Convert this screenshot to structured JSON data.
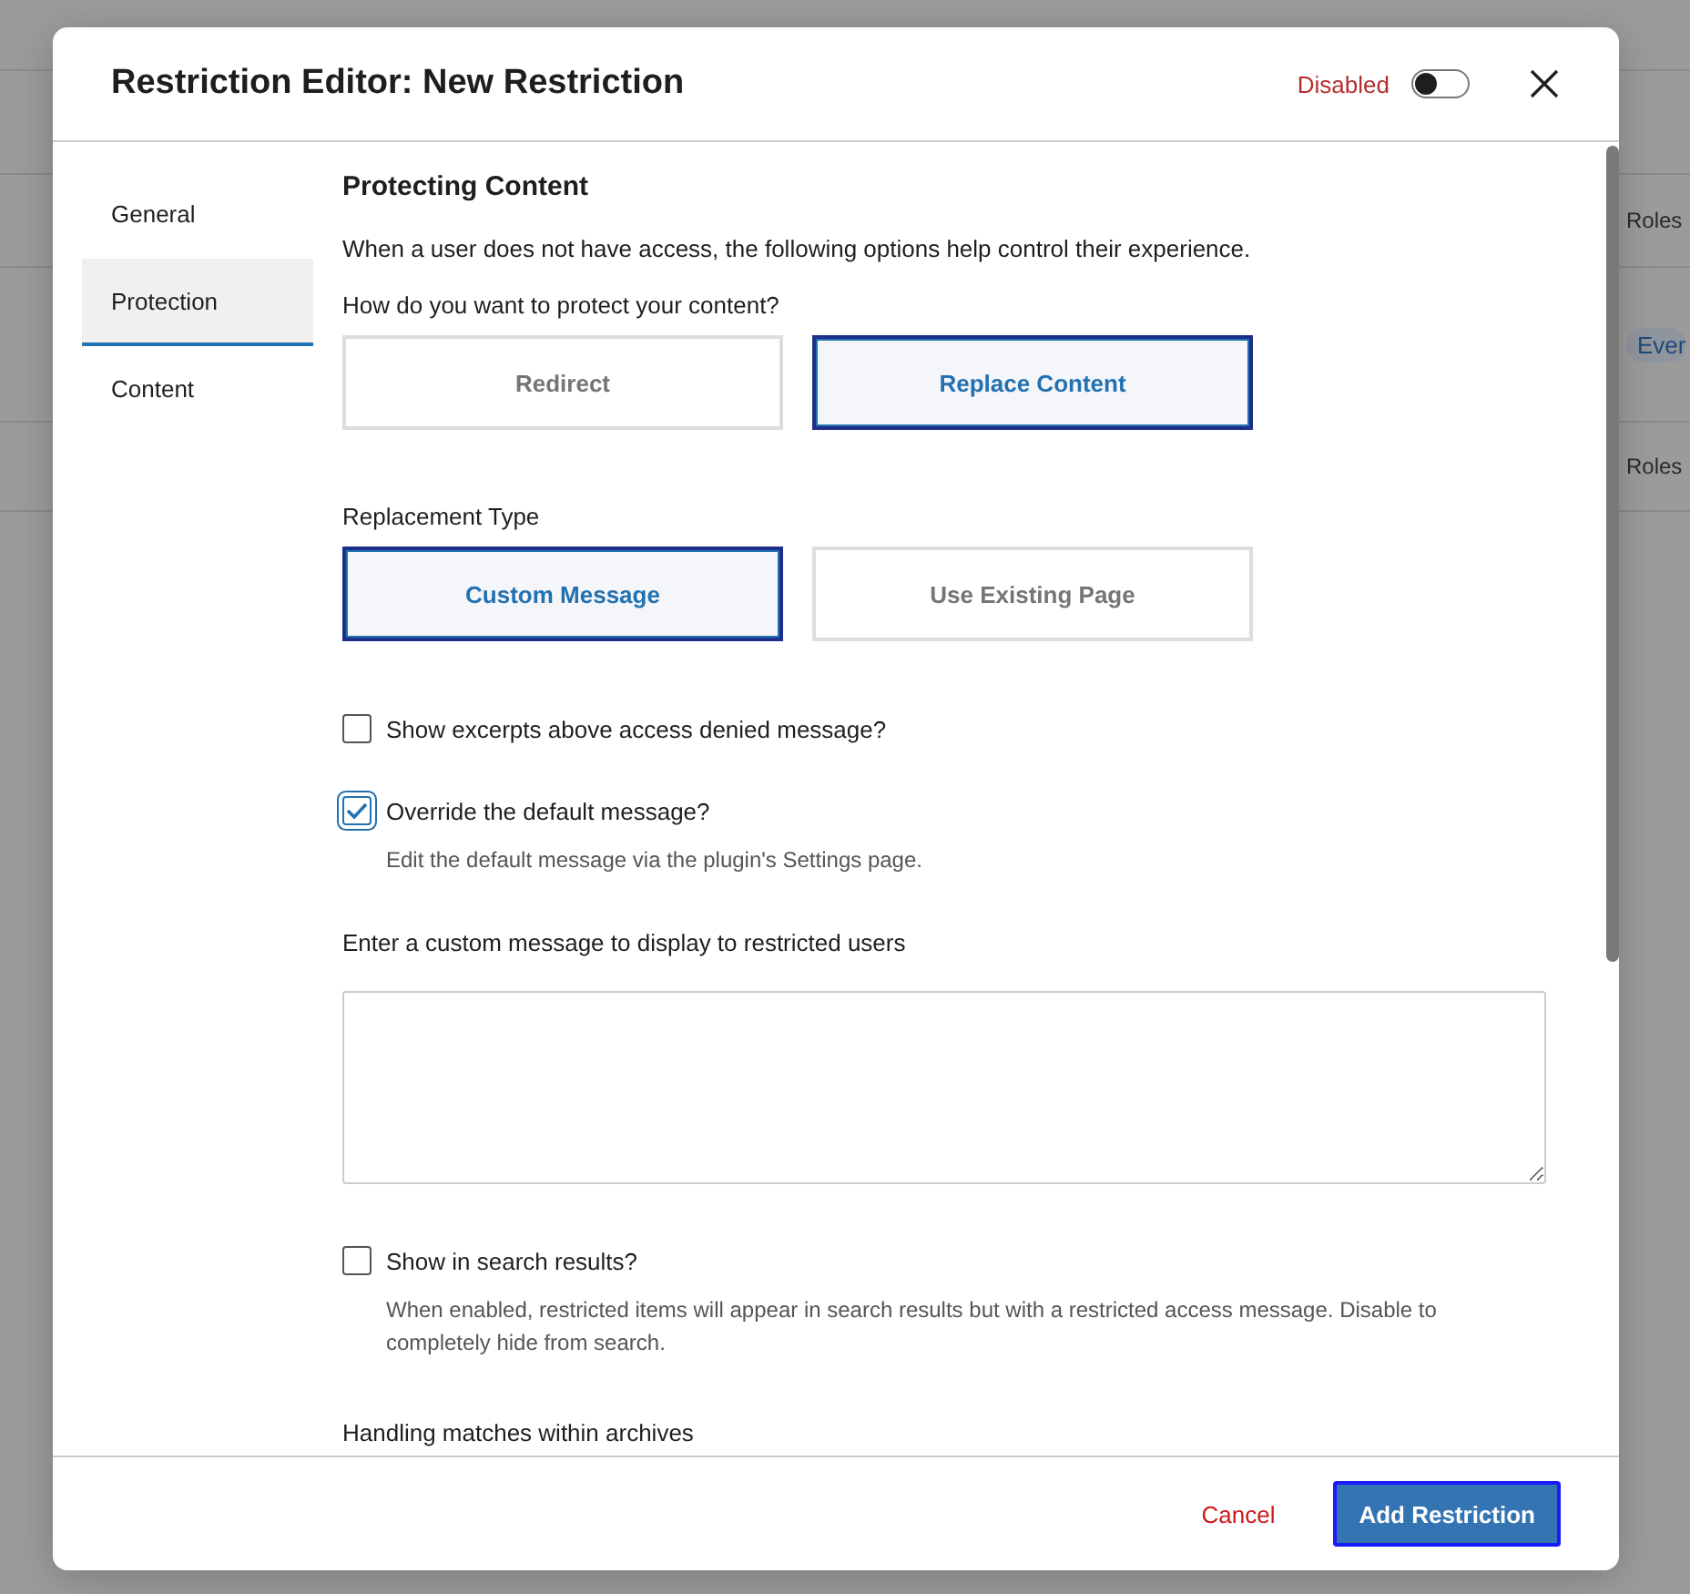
{
  "background": {
    "rows": [
      {
        "text": "Roles",
        "kind": "text"
      },
      {
        "text": "Ever",
        "kind": "badge"
      },
      {
        "text": "Roles",
        "kind": "text"
      }
    ]
  },
  "window": {
    "title": "Restriction Editor: New Restriction",
    "status": {
      "label": "Disabled",
      "on": false
    }
  },
  "sidebar": {
    "items": [
      {
        "label": "General",
        "selected": false
      },
      {
        "label": "Protection",
        "selected": true
      },
      {
        "label": "Content",
        "selected": false
      }
    ]
  },
  "section": {
    "title": "Protecting Content",
    "description": "When a user does not have access, the following options help control their experience."
  },
  "protection": {
    "label": "How do you want to protect your content?",
    "options": [
      {
        "label": "Redirect",
        "selected": false
      },
      {
        "label": "Replace Content",
        "selected": true
      }
    ]
  },
  "replacement": {
    "label": "Replacement Type",
    "options": [
      {
        "label": "Custom Message",
        "selected": true
      },
      {
        "label": "Use Existing Page",
        "selected": false
      }
    ]
  },
  "fields": [
    {
      "kind": "checkbox",
      "label": "Show excerpts above access denied message?",
      "checked": false
    },
    {
      "kind": "checkbox",
      "label": "Override the default message?",
      "checked": true,
      "help": "Edit the default message via the plugin's Settings page."
    },
    {
      "kind": "textarea",
      "label": "Enter a custom message to display to restricted users"
    },
    {
      "kind": "checkbox",
      "label": "Show in search results?",
      "checked": false,
      "help": "When enabled, restricted items will appear in search results but with a restricted access message. Disable to completely hide from search."
    },
    {
      "kind": "heading",
      "label": "Handling matches within archives"
    }
  ],
  "footer": {
    "cancel": "Cancel",
    "submit": "Add Restriction"
  }
}
